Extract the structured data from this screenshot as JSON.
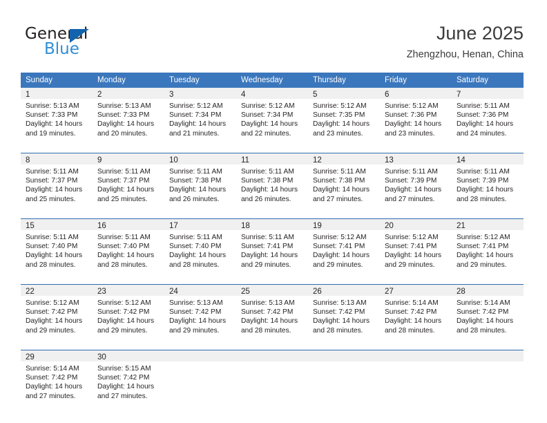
{
  "logo": {
    "word_one": "General",
    "word_two": "Blue",
    "triangle_color": "#1263ad",
    "word_two_color": "#2e8fd4"
  },
  "header": {
    "title": "June 2025",
    "subtitle": "Zhengzhou, Henan, China"
  },
  "theme": {
    "header_blue": "#3b77bc",
    "row_rule_blue": "#2f6bb0",
    "daynum_band": "#f0f0f0",
    "text": "#231f20"
  },
  "weekdays": [
    "Sunday",
    "Monday",
    "Tuesday",
    "Wednesday",
    "Thursday",
    "Friday",
    "Saturday"
  ],
  "weeks": [
    [
      {
        "day": "1",
        "sunrise": "Sunrise: 5:13 AM",
        "sunset": "Sunset: 7:33 PM",
        "daylight_1": "Daylight: 14 hours",
        "daylight_2": "and 19 minutes."
      },
      {
        "day": "2",
        "sunrise": "Sunrise: 5:13 AM",
        "sunset": "Sunset: 7:33 PM",
        "daylight_1": "Daylight: 14 hours",
        "daylight_2": "and 20 minutes."
      },
      {
        "day": "3",
        "sunrise": "Sunrise: 5:12 AM",
        "sunset": "Sunset: 7:34 PM",
        "daylight_1": "Daylight: 14 hours",
        "daylight_2": "and 21 minutes."
      },
      {
        "day": "4",
        "sunrise": "Sunrise: 5:12 AM",
        "sunset": "Sunset: 7:34 PM",
        "daylight_1": "Daylight: 14 hours",
        "daylight_2": "and 22 minutes."
      },
      {
        "day": "5",
        "sunrise": "Sunrise: 5:12 AM",
        "sunset": "Sunset: 7:35 PM",
        "daylight_1": "Daylight: 14 hours",
        "daylight_2": "and 23 minutes."
      },
      {
        "day": "6",
        "sunrise": "Sunrise: 5:12 AM",
        "sunset": "Sunset: 7:36 PM",
        "daylight_1": "Daylight: 14 hours",
        "daylight_2": "and 23 minutes."
      },
      {
        "day": "7",
        "sunrise": "Sunrise: 5:11 AM",
        "sunset": "Sunset: 7:36 PM",
        "daylight_1": "Daylight: 14 hours",
        "daylight_2": "and 24 minutes."
      }
    ],
    [
      {
        "day": "8",
        "sunrise": "Sunrise: 5:11 AM",
        "sunset": "Sunset: 7:37 PM",
        "daylight_1": "Daylight: 14 hours",
        "daylight_2": "and 25 minutes."
      },
      {
        "day": "9",
        "sunrise": "Sunrise: 5:11 AM",
        "sunset": "Sunset: 7:37 PM",
        "daylight_1": "Daylight: 14 hours",
        "daylight_2": "and 25 minutes."
      },
      {
        "day": "10",
        "sunrise": "Sunrise: 5:11 AM",
        "sunset": "Sunset: 7:38 PM",
        "daylight_1": "Daylight: 14 hours",
        "daylight_2": "and 26 minutes."
      },
      {
        "day": "11",
        "sunrise": "Sunrise: 5:11 AM",
        "sunset": "Sunset: 7:38 PM",
        "daylight_1": "Daylight: 14 hours",
        "daylight_2": "and 26 minutes."
      },
      {
        "day": "12",
        "sunrise": "Sunrise: 5:11 AM",
        "sunset": "Sunset: 7:38 PM",
        "daylight_1": "Daylight: 14 hours",
        "daylight_2": "and 27 minutes."
      },
      {
        "day": "13",
        "sunrise": "Sunrise: 5:11 AM",
        "sunset": "Sunset: 7:39 PM",
        "daylight_1": "Daylight: 14 hours",
        "daylight_2": "and 27 minutes."
      },
      {
        "day": "14",
        "sunrise": "Sunrise: 5:11 AM",
        "sunset": "Sunset: 7:39 PM",
        "daylight_1": "Daylight: 14 hours",
        "daylight_2": "and 28 minutes."
      }
    ],
    [
      {
        "day": "15",
        "sunrise": "Sunrise: 5:11 AM",
        "sunset": "Sunset: 7:40 PM",
        "daylight_1": "Daylight: 14 hours",
        "daylight_2": "and 28 minutes."
      },
      {
        "day": "16",
        "sunrise": "Sunrise: 5:11 AM",
        "sunset": "Sunset: 7:40 PM",
        "daylight_1": "Daylight: 14 hours",
        "daylight_2": "and 28 minutes."
      },
      {
        "day": "17",
        "sunrise": "Sunrise: 5:11 AM",
        "sunset": "Sunset: 7:40 PM",
        "daylight_1": "Daylight: 14 hours",
        "daylight_2": "and 28 minutes."
      },
      {
        "day": "18",
        "sunrise": "Sunrise: 5:11 AM",
        "sunset": "Sunset: 7:41 PM",
        "daylight_1": "Daylight: 14 hours",
        "daylight_2": "and 29 minutes."
      },
      {
        "day": "19",
        "sunrise": "Sunrise: 5:12 AM",
        "sunset": "Sunset: 7:41 PM",
        "daylight_1": "Daylight: 14 hours",
        "daylight_2": "and 29 minutes."
      },
      {
        "day": "20",
        "sunrise": "Sunrise: 5:12 AM",
        "sunset": "Sunset: 7:41 PM",
        "daylight_1": "Daylight: 14 hours",
        "daylight_2": "and 29 minutes."
      },
      {
        "day": "21",
        "sunrise": "Sunrise: 5:12 AM",
        "sunset": "Sunset: 7:41 PM",
        "daylight_1": "Daylight: 14 hours",
        "daylight_2": "and 29 minutes."
      }
    ],
    [
      {
        "day": "22",
        "sunrise": "Sunrise: 5:12 AM",
        "sunset": "Sunset: 7:42 PM",
        "daylight_1": "Daylight: 14 hours",
        "daylight_2": "and 29 minutes."
      },
      {
        "day": "23",
        "sunrise": "Sunrise: 5:12 AM",
        "sunset": "Sunset: 7:42 PM",
        "daylight_1": "Daylight: 14 hours",
        "daylight_2": "and 29 minutes."
      },
      {
        "day": "24",
        "sunrise": "Sunrise: 5:13 AM",
        "sunset": "Sunset: 7:42 PM",
        "daylight_1": "Daylight: 14 hours",
        "daylight_2": "and 29 minutes."
      },
      {
        "day": "25",
        "sunrise": "Sunrise: 5:13 AM",
        "sunset": "Sunset: 7:42 PM",
        "daylight_1": "Daylight: 14 hours",
        "daylight_2": "and 28 minutes."
      },
      {
        "day": "26",
        "sunrise": "Sunrise: 5:13 AM",
        "sunset": "Sunset: 7:42 PM",
        "daylight_1": "Daylight: 14 hours",
        "daylight_2": "and 28 minutes."
      },
      {
        "day": "27",
        "sunrise": "Sunrise: 5:14 AM",
        "sunset": "Sunset: 7:42 PM",
        "daylight_1": "Daylight: 14 hours",
        "daylight_2": "and 28 minutes."
      },
      {
        "day": "28",
        "sunrise": "Sunrise: 5:14 AM",
        "sunset": "Sunset: 7:42 PM",
        "daylight_1": "Daylight: 14 hours",
        "daylight_2": "and 28 minutes."
      }
    ],
    [
      {
        "day": "29",
        "sunrise": "Sunrise: 5:14 AM",
        "sunset": "Sunset: 7:42 PM",
        "daylight_1": "Daylight: 14 hours",
        "daylight_2": "and 27 minutes."
      },
      {
        "day": "30",
        "sunrise": "Sunrise: 5:15 AM",
        "sunset": "Sunset: 7:42 PM",
        "daylight_1": "Daylight: 14 hours",
        "daylight_2": "and 27 minutes."
      },
      {
        "day": "",
        "sunrise": "",
        "sunset": "",
        "daylight_1": "",
        "daylight_2": ""
      },
      {
        "day": "",
        "sunrise": "",
        "sunset": "",
        "daylight_1": "",
        "daylight_2": ""
      },
      {
        "day": "",
        "sunrise": "",
        "sunset": "",
        "daylight_1": "",
        "daylight_2": ""
      },
      {
        "day": "",
        "sunrise": "",
        "sunset": "",
        "daylight_1": "",
        "daylight_2": ""
      },
      {
        "day": "",
        "sunrise": "",
        "sunset": "",
        "daylight_1": "",
        "daylight_2": ""
      }
    ]
  ]
}
